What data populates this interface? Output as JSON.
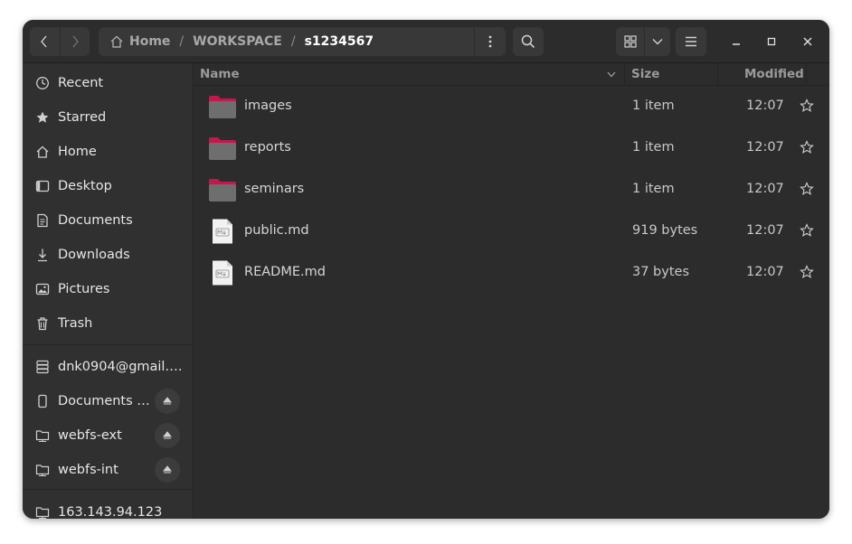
{
  "path": {
    "segments": [
      "Home",
      "WORKSPACE",
      "s1234567"
    ],
    "separator": "/"
  },
  "sidebar": {
    "places": [
      {
        "label": "Recent",
        "icon": "clock-icon"
      },
      {
        "label": "Starred",
        "icon": "star-icon"
      },
      {
        "label": "Home",
        "icon": "home-icon"
      },
      {
        "label": "Desktop",
        "icon": "desktop-icon"
      },
      {
        "label": "Documents",
        "icon": "document-icon"
      },
      {
        "label": "Downloads",
        "icon": "download-icon"
      },
      {
        "label": "Pictures",
        "icon": "picture-icon"
      },
      {
        "label": "Trash",
        "icon": "trash-icon"
      }
    ],
    "devices": [
      {
        "label": "dnk0904@gmail.c…",
        "icon": "server-icon"
      },
      {
        "label": "Documents …",
        "icon": "phone-icon"
      },
      {
        "label": "webfs-ext",
        "icon": "network-folder-icon"
      },
      {
        "label": "webfs-int",
        "icon": "network-folder-icon"
      }
    ],
    "network": [
      {
        "label": "163.143.94.123",
        "icon": "network-folder-icon"
      }
    ]
  },
  "columns": {
    "name": "Name",
    "size": "Size",
    "modified": "Modified"
  },
  "files": [
    {
      "name": "images",
      "size": "1 item",
      "modified": "12:07",
      "type": "folder"
    },
    {
      "name": "reports",
      "size": "1 item",
      "modified": "12:07",
      "type": "folder"
    },
    {
      "name": "seminars",
      "size": "1 item",
      "modified": "12:07",
      "type": "folder"
    },
    {
      "name": "public.md",
      "size": "919 bytes",
      "modified": "12:07",
      "type": "markdown"
    },
    {
      "name": "README.md",
      "size": "37 bytes",
      "modified": "12:07",
      "type": "markdown"
    }
  ],
  "colors": {
    "folder_accent": "#c7164b",
    "background": "#2c2c2c"
  }
}
